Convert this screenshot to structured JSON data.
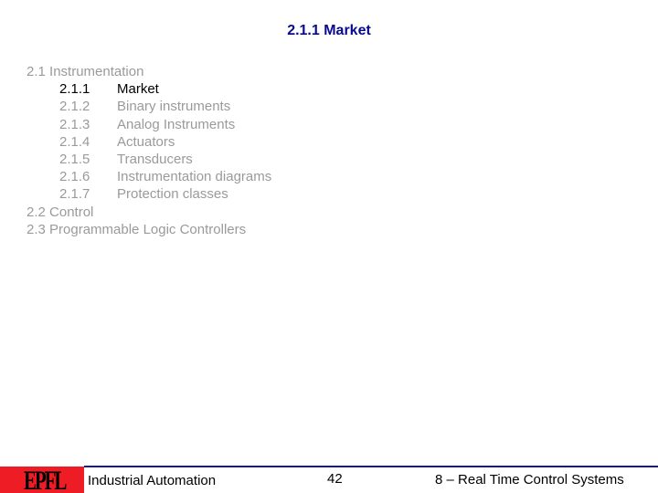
{
  "slide": {
    "title": "2.1.1 Market"
  },
  "outline": {
    "items": [
      {
        "level": 1,
        "number": "2.1",
        "label": "Instrumentation",
        "active": false
      },
      {
        "level": 2,
        "number": "2.1.1",
        "label": "Market",
        "active": true
      },
      {
        "level": 2,
        "number": "2.1.2",
        "label": "Binary instruments",
        "active": false
      },
      {
        "level": 2,
        "number": "2.1.3",
        "label": "Analog Instruments",
        "active": false
      },
      {
        "level": 2,
        "number": "2.1.4",
        "label": "Actuators",
        "active": false
      },
      {
        "level": 2,
        "number": "2.1.5",
        "label": "Transducers",
        "active": false
      },
      {
        "level": 2,
        "number": "2.1.6",
        "label": "Instrumentation diagrams",
        "active": false
      },
      {
        "level": 2,
        "number": "2.1.7",
        "label": "Protection classes",
        "active": false
      },
      {
        "level": 1,
        "number": "2.2",
        "label": "Control",
        "active": false
      },
      {
        "level": 1,
        "number": "2.3",
        "label": "Programmable Logic Controllers",
        "active": false
      }
    ]
  },
  "footer": {
    "logo_text": "EPFL",
    "course": "Industrial Automation",
    "page_number": "42",
    "chapter": "8 – Real Time Control Systems"
  },
  "colors": {
    "title": "#0a0a8c",
    "inactive_text": "#9a9a9a",
    "active_text": "#000000",
    "logo_red": "#ee1c25",
    "footer_line": "#1a1a6e"
  }
}
